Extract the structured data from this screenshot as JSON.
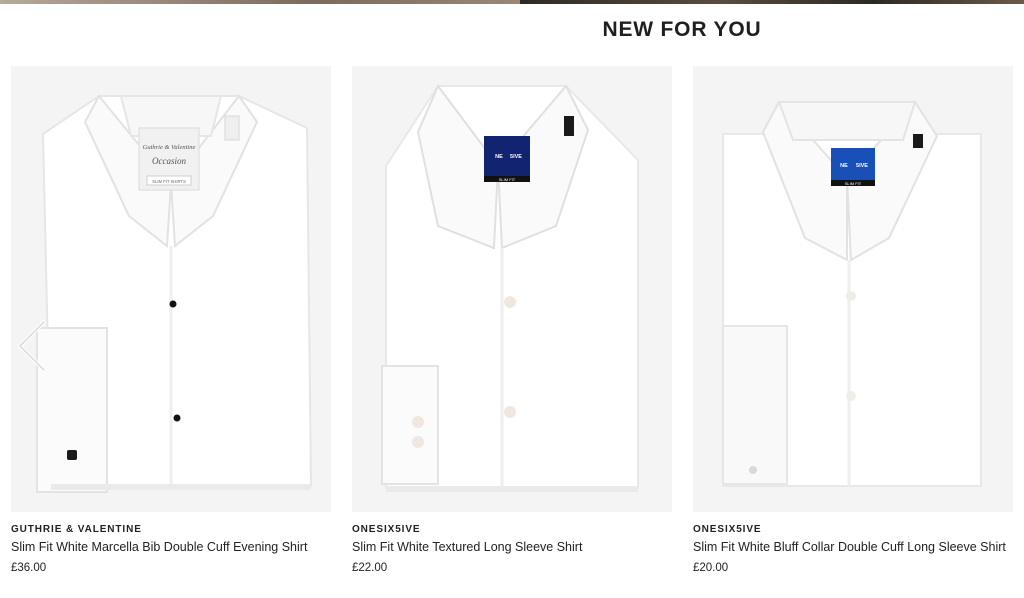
{
  "header": {
    "title": "NEW FOR YOU"
  },
  "products": [
    {
      "brand": "GUTHRIE & VALENTINE",
      "name": "Slim Fit White Marcella Bib Double Cuff Evening Shirt",
      "price": "£36.00",
      "label_lines": [
        "Guthrie & Valentine",
        "Occasion",
        "SLIM FIT SHIRTS"
      ]
    },
    {
      "brand": "ONESIX5IVE",
      "name": "Slim Fit White Textured Long Sleeve Shirt",
      "price": "£22.00",
      "label_lines": [
        "NE",
        "5IVE",
        "SLIM FIT"
      ]
    },
    {
      "brand": "ONESIX5IVE",
      "name": "Slim Fit White Bluff Collar Double Cuff Long Sleeve Shirt",
      "price": "£20.00",
      "label_lines": [
        "NE",
        "5IVE",
        "SLIM FIT"
      ]
    }
  ],
  "carousel": {
    "prev_icon": "chevron-left-icon"
  }
}
